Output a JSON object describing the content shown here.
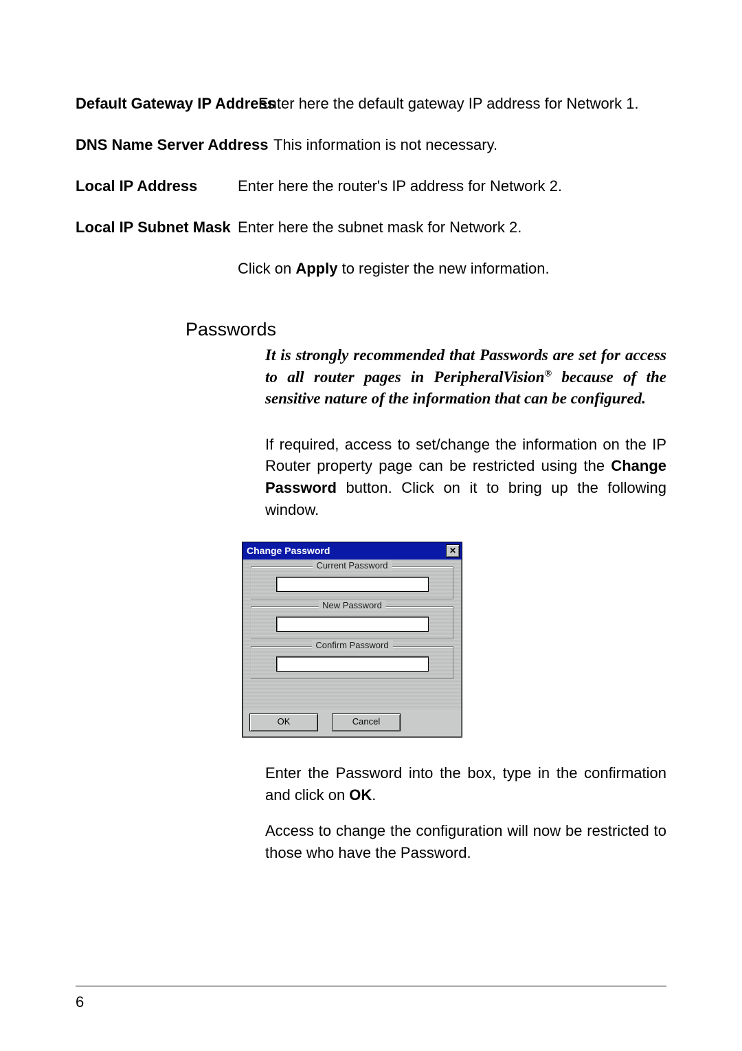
{
  "definitions": {
    "gateway": {
      "label": "Default Gateway IP Address",
      "desc": "Enter here the default gateway IP address for Network 1."
    },
    "dns": {
      "label": "DNS Name Server Address",
      "desc": "This information is not necessary."
    },
    "local_ip": {
      "label": "Local IP Address",
      "desc": "Enter here the router's IP address for Network 2."
    },
    "local_subnet": {
      "label": "Local IP Subnet Mask",
      "desc": "Enter here the subnet mask for Network 2."
    },
    "apply": {
      "pre": "Click on ",
      "bold": "Apply",
      "post": " to register the new information."
    }
  },
  "passwords": {
    "heading": "Passwords",
    "recommendation_pre": "It is strongly recommended that Passwords are set for access to all router pages in PeripheralVision",
    "recommendation_reg": "®",
    "recommendation_post": " because of the sensitive nature of the information that can be configured.",
    "intro_pre": "If required, access to set/change the information on the IP Router property page can be restricted using the ",
    "intro_bold": "Change Password",
    "intro_post": " button.  Click on it to bring up the following window.",
    "after1_pre": "Enter the Password into the box, type in the confirmation and  click on ",
    "after1_bold": "OK",
    "after1_post": ".",
    "after2": "Access to change the configuration will now be restricted to those who have the Password."
  },
  "dialog": {
    "title": "Change Password",
    "close_glyph": "✕",
    "current_label": "Current Password",
    "new_label": "New Password",
    "confirm_label": "Confirm Password",
    "ok": "OK",
    "cancel": "Cancel"
  },
  "page_number": "6"
}
